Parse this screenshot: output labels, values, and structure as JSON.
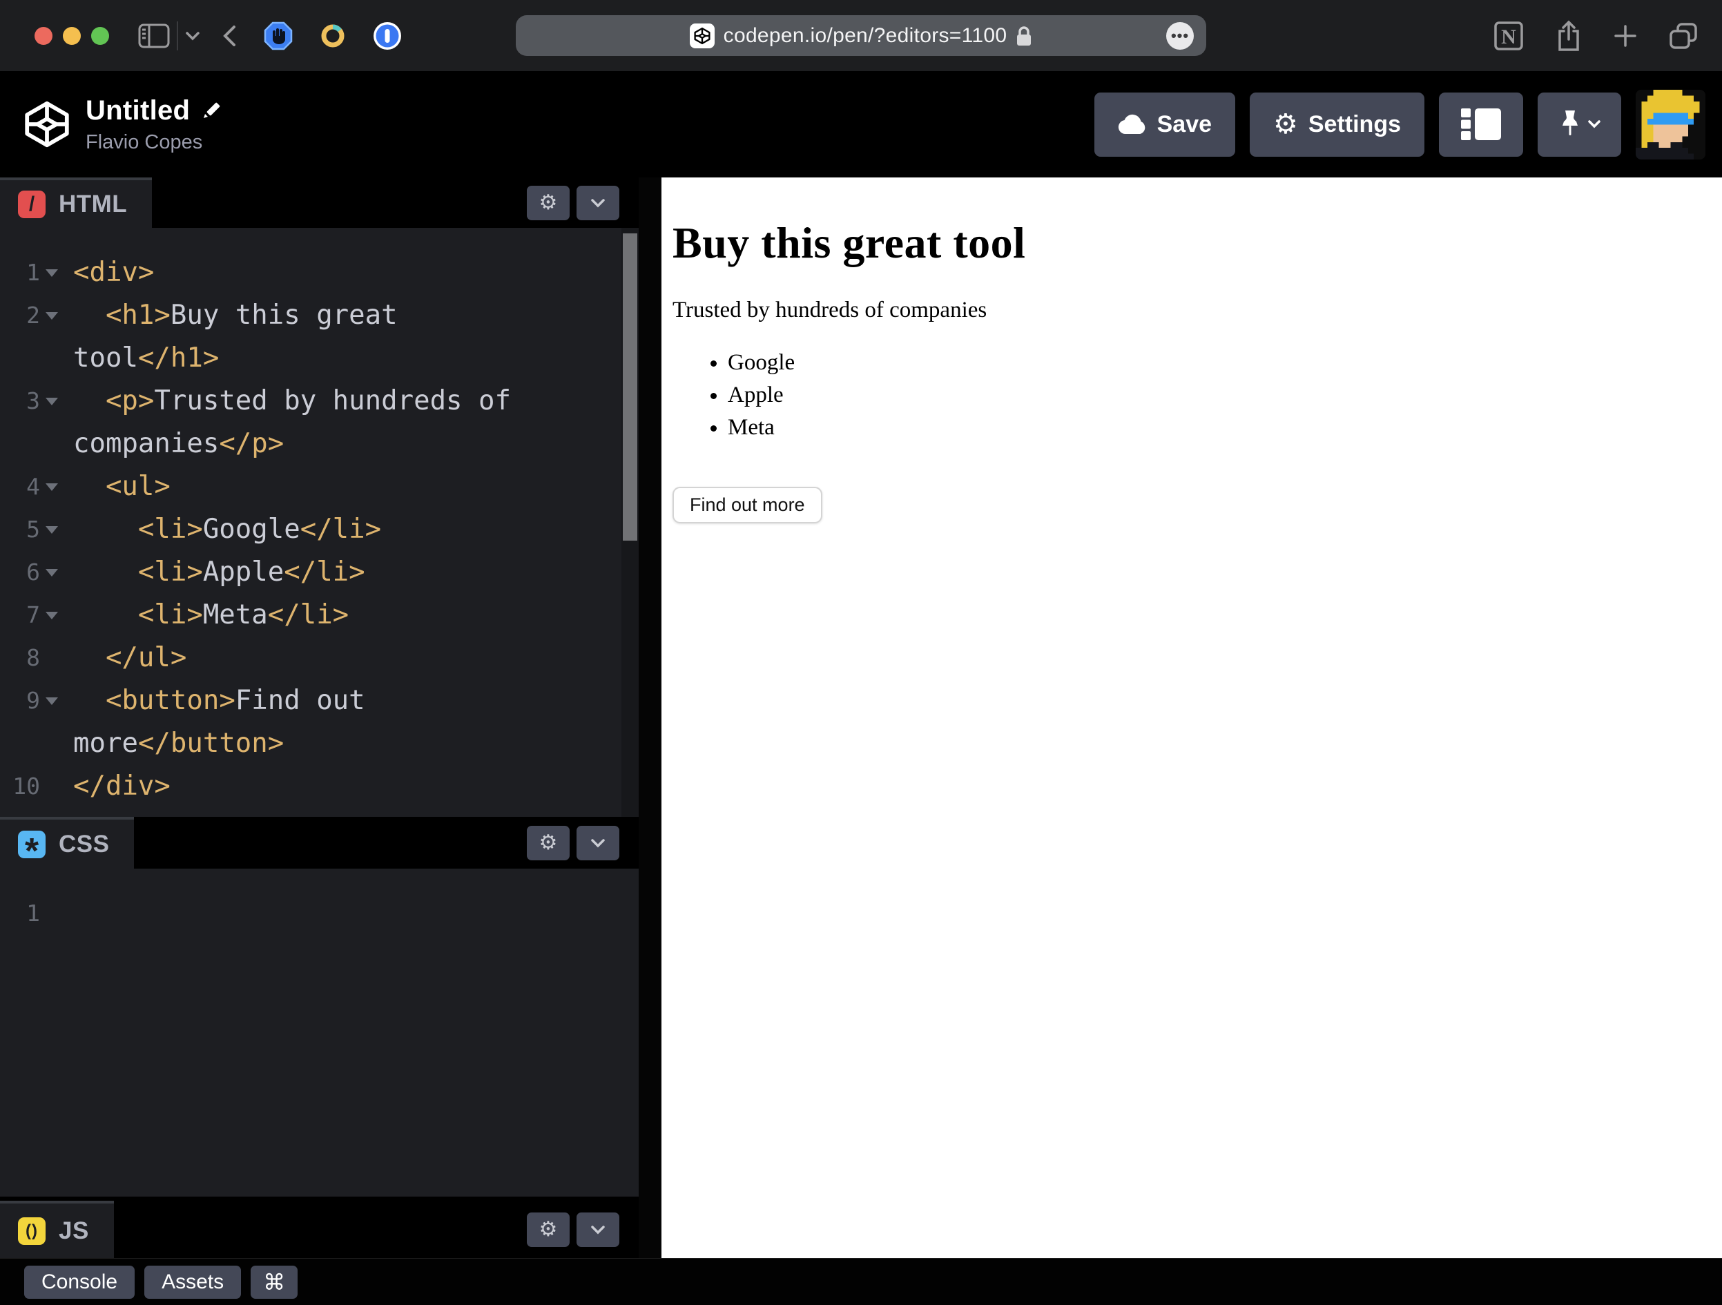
{
  "browser": {
    "url": "codepen.io/pen/?editors=1100"
  },
  "header": {
    "title": "Untitled",
    "author": "Flavio Copes",
    "save_label": "Save",
    "settings_label": "Settings"
  },
  "editors": {
    "html": {
      "label": "HTML",
      "icon": "/",
      "lines": [
        {
          "n": "1",
          "fold": true,
          "ind": 0,
          "seg": [
            {
              "t": "<div>",
              "c": "tag"
            }
          ]
        },
        {
          "n": "2",
          "fold": true,
          "ind": 2,
          "seg": [
            {
              "t": "<h1>",
              "c": "tag"
            },
            {
              "t": "Buy this great",
              "c": "txt"
            }
          ]
        },
        {
          "n": "",
          "fold": false,
          "ind": 0,
          "seg": [
            {
              "t": "tool",
              "c": "txt"
            },
            {
              "t": "</h1>",
              "c": "tag"
            }
          ]
        },
        {
          "n": "3",
          "fold": true,
          "ind": 2,
          "seg": [
            {
              "t": "<p>",
              "c": "tag"
            },
            {
              "t": "Trusted by hundreds of",
              "c": "txt"
            }
          ]
        },
        {
          "n": "",
          "fold": false,
          "ind": 0,
          "seg": [
            {
              "t": "companies",
              "c": "txt"
            },
            {
              "t": "</p>",
              "c": "tag"
            }
          ]
        },
        {
          "n": "4",
          "fold": true,
          "ind": 2,
          "seg": [
            {
              "t": "<ul>",
              "c": "tag"
            }
          ]
        },
        {
          "n": "5",
          "fold": true,
          "ind": 4,
          "seg": [
            {
              "t": "<li>",
              "c": "tag"
            },
            {
              "t": "Google",
              "c": "txt"
            },
            {
              "t": "</li>",
              "c": "tag"
            }
          ]
        },
        {
          "n": "6",
          "fold": true,
          "ind": 4,
          "seg": [
            {
              "t": "<li>",
              "c": "tag"
            },
            {
              "t": "Apple",
              "c": "txt"
            },
            {
              "t": "</li>",
              "c": "tag"
            }
          ]
        },
        {
          "n": "7",
          "fold": true,
          "ind": 4,
          "seg": [
            {
              "t": "<li>",
              "c": "tag"
            },
            {
              "t": "Meta",
              "c": "txt"
            },
            {
              "t": "</li>",
              "c": "tag"
            }
          ]
        },
        {
          "n": "8",
          "fold": false,
          "ind": 2,
          "seg": [
            {
              "t": "</ul>",
              "c": "tag"
            }
          ]
        },
        {
          "n": "9",
          "fold": true,
          "ind": 2,
          "seg": [
            {
              "t": "<button>",
              "c": "tag"
            },
            {
              "t": "Find out",
              "c": "txt"
            }
          ]
        },
        {
          "n": "",
          "fold": false,
          "ind": 0,
          "seg": [
            {
              "t": "more",
              "c": "txt"
            },
            {
              "t": "</button>",
              "c": "tag"
            }
          ]
        },
        {
          "n": "10",
          "fold": false,
          "ind": 0,
          "seg": [
            {
              "t": "</div>",
              "c": "tag"
            }
          ]
        }
      ]
    },
    "css": {
      "label": "CSS",
      "icon": "*",
      "lines": [
        {
          "n": "1",
          "fold": false,
          "ind": 0,
          "seg": []
        }
      ]
    },
    "js": {
      "label": "JS",
      "icon": "()",
      "lines": []
    }
  },
  "preview": {
    "heading": "Buy this great tool",
    "paragraph": "Trusted by hundreds of companies",
    "list": [
      "Google",
      "Apple",
      "Meta"
    ],
    "button_label": "Find out more"
  },
  "footer": {
    "console_label": "Console",
    "assets_label": "Assets",
    "cmd_label": "⌘"
  },
  "icons": {
    "save": "cloud-icon",
    "settings": "gear-icon",
    "url_lock": "lock-icon",
    "extensions": [
      "hand-blocker-icon",
      "ring-icon",
      "onepassword-icon"
    ]
  },
  "colors": {
    "html_accent": "#e24f4f",
    "css_accent": "#58b7f3",
    "js_accent": "#f3d53c",
    "code_tag": "#deb46e",
    "code_text": "#cbcdd6",
    "panel_bg": "#1d1e22",
    "button_bg": "#444857"
  }
}
